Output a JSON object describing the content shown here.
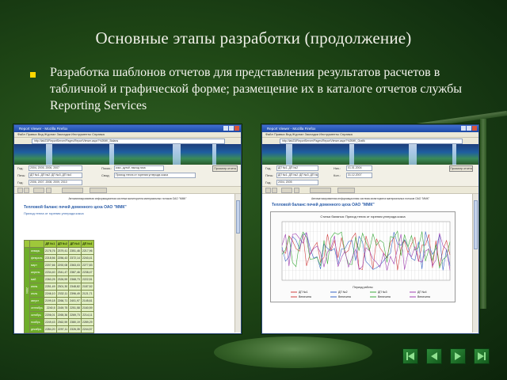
{
  "slide": {
    "title": "Основные этапы разработки (продолжение)",
    "bullet": "Разработка шаблонов отчетов для представления результатов расчетов в табличной и графической форме; размещение их в каталоге отчетов службы Reporting Services"
  },
  "left_window": {
    "title": "Report Viewer - Mozilla Firefox",
    "menu": "Файл  Правка  Вид  Журнал  Закладки  Инструменты  Справка",
    "address": "http://lab23/ReportServer/Pages/ReportViewer.aspx?%2fMK_Balans",
    "params": [
      {
        "label": "Год:",
        "value": "2004, 2005, 2006, 2007"
      },
      {
        "label": "Печь:",
        "value": "ДП №1, ДП №2, ДП №3, ДП №4"
      },
      {
        "label": "Год:",
        "value": "2006, 2007, 2008, 2009, 2010"
      }
    ],
    "params_right": [
      {
        "label": "Показ.:",
        "value": "кокс, дутьё, выход газа"
      },
      {
        "label": "Свод:",
        "value": "Приход тепла от горения углерода кокса"
      }
    ],
    "view_button": "Просмотр отчета",
    "report_header": "Автоматизированная информационная система мониторинга материальных потоков ОАО \"ММК\"",
    "report_title": "Тепловой баланс печей доменного цеха ОАО \"ММК\"",
    "report_sub": "Приход тепла от горения углерода кокса",
    "table": {
      "headers": [
        "ДП №1",
        "ДП №2",
        "ДП №3",
        "ДП №4"
      ],
      "year": "2004",
      "rows": [
        {
          "month": "январь",
          "values": [
            "2176,76",
            "2379,41",
            "2351,46",
            "2217,96"
          ]
        },
        {
          "month": "февраль",
          "values": [
            "2218,56",
            "2256,43",
            "2372,14",
            "2240,41"
          ]
        },
        {
          "month": "март",
          "values": [
            "2207,66",
            "2292,08",
            "2363,03",
            "2277,83"
          ]
        },
        {
          "month": "апрель",
          "values": [
            "2234,40",
            "2341,47",
            "2387,46",
            "2238,47"
          ]
        },
        {
          "month": "май",
          "values": [
            "2260,25",
            "2326,59",
            "2368,73",
            "2222,51"
          ]
        },
        {
          "month": "июнь",
          "values": [
            "2251,49",
            "2301,30",
            "2348,82",
            "2187,52"
          ]
        },
        {
          "month": "июль",
          "values": [
            "2246,10",
            "2332,11",
            "2396,49",
            "2121,71"
          ]
        },
        {
          "month": "август",
          "values": [
            "2199,18",
            "2266,71",
            "2401,97",
            "2145,61"
          ]
        },
        {
          "month": "сентябрь",
          "values": [
            "2240,5",
            "2169,75",
            "2251,58",
            "2160,59"
          ]
        },
        {
          "month": "октябрь",
          "values": [
            "2206,01",
            "2265,36",
            "2269,73",
            "2214,11"
          ]
        },
        {
          "month": "ноябрь",
          "values": [
            "2249,43",
            "2362,59",
            "2380,19",
            "2289,29"
          ]
        },
        {
          "month": "декабрь",
          "values": [
            "2284,20",
            "2297,11",
            "2326,35",
            "2244,57"
          ]
        }
      ]
    }
  },
  "right_window": {
    "title": "Report Viewer - Mozilla Firefox",
    "menu": "Файл  Правка  Вид  Журнал  Закладки  Инструменты  Справка",
    "address": "http://lab23/ReportServer/Pages/ReportViewer.aspx?%2fMK_Grafik",
    "params": [
      {
        "label": "Год:",
        "value": "ДП №1, ДП №2"
      },
      {
        "label": "Печь:",
        "value": "ДП №1, ДП №2, ДП №3, ДП №4"
      },
      {
        "label": "Год:",
        "value": "2004, 2005"
      }
    ],
    "params_right": [
      {
        "label": "Нач.:",
        "value": "01.01.2004"
      },
      {
        "label": "Кон.:",
        "value": "31.12.2007"
      }
    ],
    "view_button": "Просмотр отчета",
    "report_header": "Автоматизированная информационная система мониторинга материальных потоков ОАО \"ММК\"",
    "report_title": "Тепловой баланс печей доменного цеха ОАО \"ММК\"",
    "chart_title": "Статья баланса: Приход тепла от горения углерода кокса",
    "chart_xlabel": "Период работы",
    "legend": [
      "ДП №1",
      "ДП №2",
      "ДП №3",
      "ДП №4",
      "Величина",
      "Величина",
      "Величина",
      "Величина"
    ],
    "series_colors": [
      "#d04040",
      "#3a66c4",
      "#3caa3c",
      "#a040b0"
    ]
  },
  "nav": {
    "first_icon": "first-slide-icon",
    "prev_icon": "previous-slide-icon",
    "next_icon": "next-slide-icon",
    "last_icon": "last-slide-icon"
  }
}
